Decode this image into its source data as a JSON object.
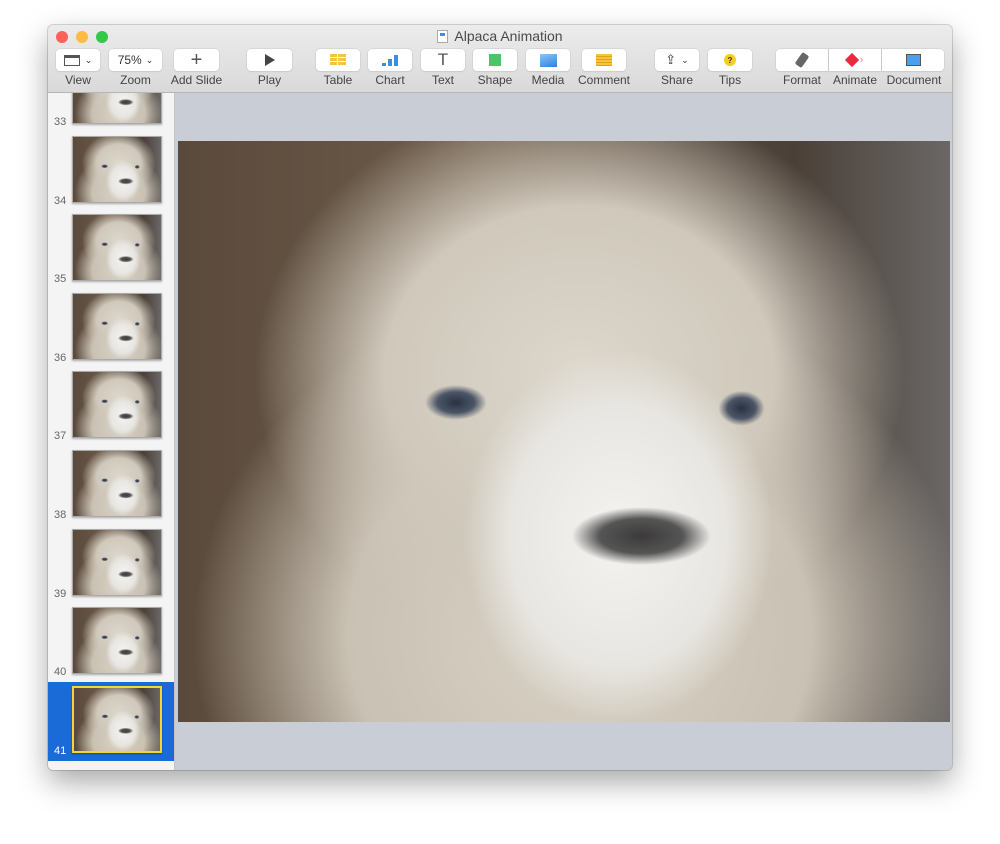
{
  "window": {
    "title": "Alpaca Animation"
  },
  "toolbar": {
    "view": {
      "label": "View",
      "icon": "sidebar-view-icon"
    },
    "zoom": {
      "label": "Zoom",
      "value": "75%"
    },
    "add_slide": {
      "label": "Add Slide",
      "icon": "plus-icon"
    },
    "play": {
      "label": "Play",
      "icon": "play-icon"
    },
    "table": {
      "label": "Table",
      "icon": "table-icon"
    },
    "chart": {
      "label": "Chart",
      "icon": "bar-chart-icon"
    },
    "text": {
      "label": "Text",
      "icon": "text-icon"
    },
    "shape": {
      "label": "Shape",
      "icon": "square-icon"
    },
    "media": {
      "label": "Media",
      "icon": "image-icon"
    },
    "comment": {
      "label": "Comment",
      "icon": "comment-icon"
    },
    "share": {
      "label": "Share",
      "icon": "share-icon"
    },
    "tips": {
      "label": "Tips",
      "icon": "question-icon"
    },
    "format": {
      "label": "Format",
      "icon": "paintbrush-icon"
    },
    "animate": {
      "label": "Animate",
      "icon": "diamond-icon"
    },
    "document": {
      "label": "Document",
      "icon": "document-icon"
    }
  },
  "colors": {
    "accent": "#1a6ad8",
    "selection_border": "#f2d43b",
    "close": "#fc605b",
    "minimize": "#fdbc40",
    "zoom": "#34c84a"
  },
  "slides": [
    "33",
    "34",
    "35",
    "36",
    "37",
    "38",
    "39",
    "40",
    "41"
  ],
  "selected_slide": "41"
}
